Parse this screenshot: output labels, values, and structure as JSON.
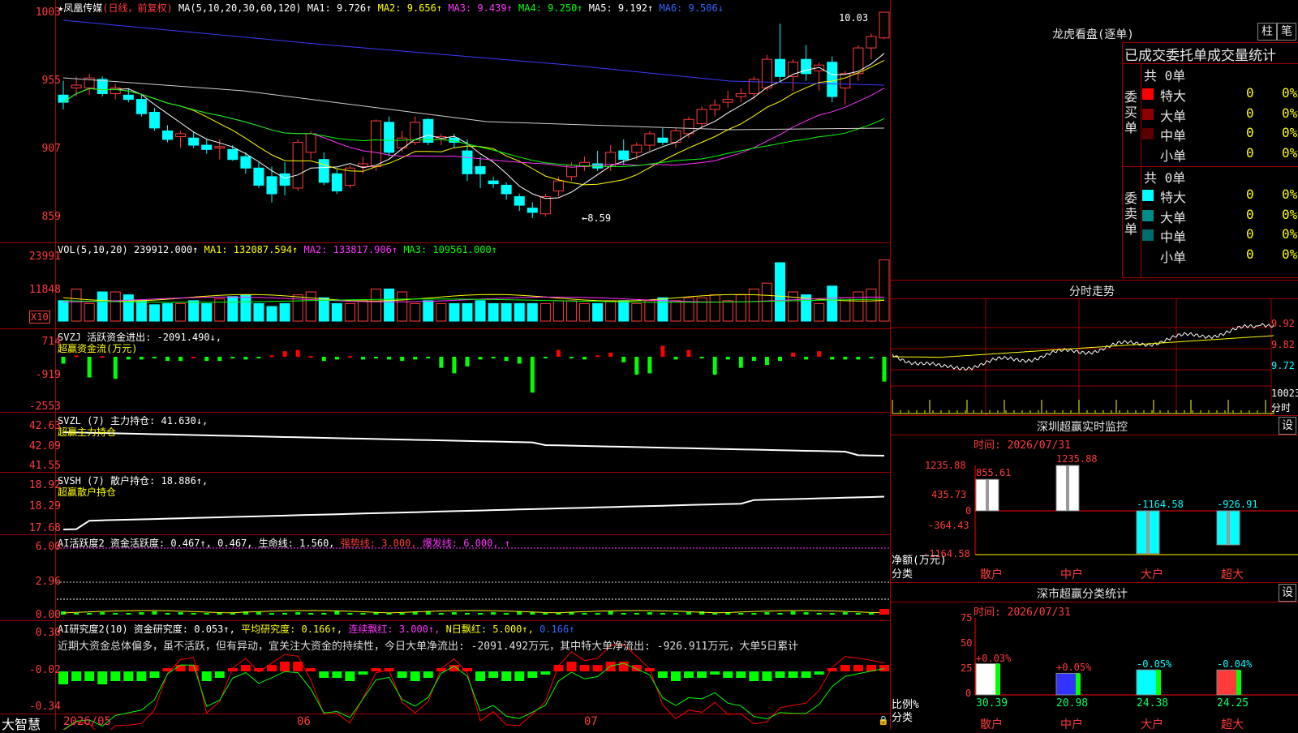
{
  "stock": {
    "star": "★",
    "name": "凤凰传媒",
    "period": "(日线，前复权)",
    "ma_prefix": "MA(5,10,20,30,60,120)",
    "ma1": "MA1: 9.726↑",
    "ma2": "MA2: 9.656↑",
    "ma3": "MA3: 9.439↑",
    "ma4": "MA4: 9.250↑",
    "ma5": "MA5: 9.192↑",
    "ma6": "MA6: 9.506↓",
    "high_label": "10.03",
    "low_label": "8.59",
    "y_ticks": [
      "1003",
      "955",
      "907",
      "859"
    ]
  },
  "vol": {
    "title": "VOL(5,10,20)",
    "value": "239912.000↑",
    "ma1": "MA1: 132087.594↑",
    "ma2": "MA2: 133817.906↑",
    "ma3": "MA3: 109561.000↑",
    "y_ticks": [
      "23991",
      "11848"
    ],
    "unit": "X10"
  },
  "svzj": {
    "line1": "SVZJ  活跃资金进出: -2091.490↓,",
    "line2": "超赢资金流(万元)",
    "y_ticks": [
      "714",
      "-919",
      "-2553"
    ]
  },
  "svzl": {
    "line1": "SVZL (7) 主力持仓: 41.630↓,",
    "line2": "超赢主力持仓",
    "y_ticks": [
      "42.63",
      "42.09",
      "41.55"
    ]
  },
  "svsh": {
    "line1": "SVSH (7) 散户持仓: 18.886↑,",
    "line2": "超赢散户持仓",
    "y_ticks": [
      "18.92",
      "18.29",
      "17.68"
    ]
  },
  "ai_active": {
    "t1": "AI活跃度2 资金活跃度: 0.467↑, 0.467, 生命线: 1.560,",
    "t2": "强势线: 3.000,",
    "t3": "爆发线: 6.000,",
    "y_ticks": [
      "6.00",
      "2.96",
      "0.00"
    ]
  },
  "ai_research": {
    "t1": "AI研究度2(10) 资金研究度: 0.053↑,",
    "t2": "平均研究度: 0.166↑,",
    "t3": "连续飘红: 3.000↑,",
    "t4": "N日飘红: 5.000↑,",
    "t5": "0.166↑",
    "comment": "近期大资金总体偏多，虽不活跃，但有异动，宜关注大资金的持续性，今日大单净流出: -2091.492万元，其中特大单净流出: -926.911万元，大单5日累计",
    "y_ticks": [
      "0.30",
      "-0.02",
      "-0.34"
    ]
  },
  "bottom": {
    "brand": "大智慧",
    "dates": [
      "2026/05",
      "06",
      "07"
    ]
  },
  "right": {
    "lhb_title": "龙虎看盘(逐单)",
    "btn_bar": "柱",
    "btn_pen": "笔",
    "tab_title": "已成交委托单成交量统计",
    "buy_label": "委买单",
    "sell_label": "委卖单",
    "buy_total": "共 0单",
    "sell_total": "共 0单",
    "buy_rows": [
      {
        "name": "特大",
        "v": "0",
        "p": "0%",
        "color": "#ff0000"
      },
      {
        "name": "大单",
        "v": "0",
        "p": "0%",
        "color": "#8b0000"
      },
      {
        "name": "中单",
        "v": "0",
        "p": "0%",
        "color": "#5a0000"
      },
      {
        "name": "小单",
        "v": "0",
        "p": "0%",
        "color": "#000000"
      }
    ],
    "sell_rows": [
      {
        "name": "特大",
        "v": "0",
        "p": "0%",
        "color": "#00ffff"
      },
      {
        "name": "大单",
        "v": "0",
        "p": "0%",
        "color": "#008b8b"
      },
      {
        "name": "中单",
        "v": "0",
        "p": "0%",
        "color": "#006d6d"
      },
      {
        "name": "小单",
        "v": "0",
        "p": "0%",
        "color": "#000000"
      }
    ],
    "intraday_title": "分时走势",
    "intraday_ticks": [
      "9.92",
      "9.82",
      "9.72"
    ],
    "intraday_vol": "10023",
    "intraday_vol_label": "分时",
    "monitor_title": "深圳超赢实时监控",
    "monitor_time": "时间: 2026/07/31",
    "monitor_set": "设",
    "monitor_ticks": [
      "1235.88",
      "435.73",
      "0",
      "-364.43",
      "-1164.58"
    ],
    "monitor_ylabel1": "净额(万元)",
    "monitor_ylabel2": "分类",
    "monitor_cats": [
      "散户",
      "中户",
      "大户",
      "超大"
    ],
    "monitor_vals": [
      "855.61",
      "1235.88",
      "-1164.58",
      "-926.91"
    ],
    "class_title": "深市超赢分类统计",
    "class_time": "时间: 2026/07/31",
    "class_set": "设",
    "class_ticks": [
      "75",
      "50",
      "25",
      "0"
    ],
    "class_ylabel1": "比例%",
    "class_ylabel2": "分类",
    "class_cats": [
      "散户",
      "中户",
      "大户",
      "超大"
    ],
    "class_vals": [
      "30.39",
      "20.98",
      "24.38",
      "24.25"
    ],
    "class_changes": [
      "+0.03%",
      "+0.05%",
      "-0.05%",
      "-0.04%"
    ]
  },
  "chart_data": [
    {
      "type": "candlestick",
      "title": "凤凰传媒 (日线，前复权)",
      "ylim": [
        8.5,
        10.1
      ],
      "ohlc": [
        [
          9.45,
          9.55,
          9.35,
          9.4
        ],
        [
          9.5,
          9.58,
          9.44,
          9.52
        ],
        [
          9.5,
          9.6,
          9.45,
          9.57
        ],
        [
          9.56,
          9.58,
          9.44,
          9.46
        ],
        [
          9.46,
          9.53,
          9.42,
          9.5
        ],
        [
          9.45,
          9.5,
          9.4,
          9.42
        ],
        [
          9.42,
          9.46,
          9.3,
          9.32
        ],
        [
          9.33,
          9.36,
          9.2,
          9.22
        ],
        [
          9.2,
          9.24,
          9.12,
          9.14
        ],
        [
          9.16,
          9.2,
          9.08,
          9.18
        ],
        [
          9.15,
          9.19,
          9.08,
          9.1
        ],
        [
          9.1,
          9.14,
          9.04,
          9.07
        ],
        [
          9.08,
          9.14,
          9.0,
          9.09
        ],
        [
          9.07,
          9.1,
          8.99,
          9.0
        ],
        [
          9.02,
          9.05,
          8.9,
          8.94
        ],
        [
          8.94,
          8.98,
          8.8,
          8.82
        ],
        [
          8.88,
          8.95,
          8.7,
          8.76
        ],
        [
          8.9,
          8.98,
          8.75,
          8.82
        ],
        [
          8.8,
          9.14,
          8.78,
          9.12
        ],
        [
          9.05,
          9.2,
          9.0,
          9.18
        ],
        [
          9.0,
          9.05,
          8.82,
          8.84
        ],
        [
          8.9,
          8.93,
          8.76,
          8.78
        ],
        [
          8.82,
          8.96,
          8.8,
          8.94
        ],
        [
          8.95,
          9.02,
          8.9,
          8.97
        ],
        [
          8.95,
          9.28,
          8.92,
          9.27
        ],
        [
          9.26,
          9.3,
          9.02,
          9.05
        ],
        [
          9.08,
          9.2,
          9.05,
          9.15
        ],
        [
          9.12,
          9.3,
          9.1,
          9.26
        ],
        [
          9.28,
          9.29,
          9.1,
          9.12
        ],
        [
          9.14,
          9.18,
          9.1,
          9.16
        ],
        [
          9.15,
          9.18,
          9.08,
          9.12
        ],
        [
          9.06,
          9.14,
          8.85,
          8.9
        ],
        [
          8.95,
          9.02,
          8.8,
          8.9
        ],
        [
          8.85,
          8.88,
          8.8,
          8.83
        ],
        [
          8.82,
          8.84,
          8.72,
          8.76
        ],
        [
          8.74,
          8.76,
          8.64,
          8.68
        ],
        [
          8.66,
          8.7,
          8.59,
          8.63
        ],
        [
          8.62,
          8.76,
          8.6,
          8.74
        ],
        [
          8.78,
          8.88,
          8.74,
          8.85
        ],
        [
          8.88,
          8.98,
          8.85,
          8.96
        ],
        [
          8.95,
          9.02,
          8.92,
          8.98
        ],
        [
          8.97,
          9.06,
          8.92,
          8.94
        ],
        [
          8.95,
          9.1,
          8.92,
          9.05
        ],
        [
          9.06,
          9.14,
          8.96,
          9.0
        ],
        [
          9.05,
          9.12,
          9.0,
          9.1
        ],
        [
          9.1,
          9.2,
          9.06,
          9.18
        ],
        [
          9.15,
          9.22,
          9.1,
          9.12
        ],
        [
          9.12,
          9.22,
          9.08,
          9.2
        ],
        [
          9.18,
          9.3,
          9.15,
          9.28
        ],
        [
          9.25,
          9.37,
          9.22,
          9.35
        ],
        [
          9.35,
          9.42,
          9.3,
          9.38
        ],
        [
          9.4,
          9.48,
          9.36,
          9.42
        ],
        [
          9.44,
          9.5,
          9.4,
          9.46
        ],
        [
          9.46,
          9.58,
          9.42,
          9.56
        ],
        [
          9.5,
          9.73,
          9.48,
          9.7
        ],
        [
          9.7,
          9.95,
          9.55,
          9.58
        ],
        [
          9.58,
          9.7,
          9.48,
          9.68
        ],
        [
          9.7,
          9.8,
          9.55,
          9.6
        ],
        [
          9.62,
          9.68,
          9.48,
          9.66
        ],
        [
          9.68,
          9.72,
          9.4,
          9.44
        ],
        [
          9.5,
          9.62,
          9.38,
          9.6
        ],
        [
          9.6,
          9.8,
          9.55,
          9.78
        ],
        [
          9.78,
          9.88,
          9.7,
          9.86
        ],
        [
          9.85,
          10.03,
          9.84,
          10.03
        ]
      ]
    }
  ]
}
